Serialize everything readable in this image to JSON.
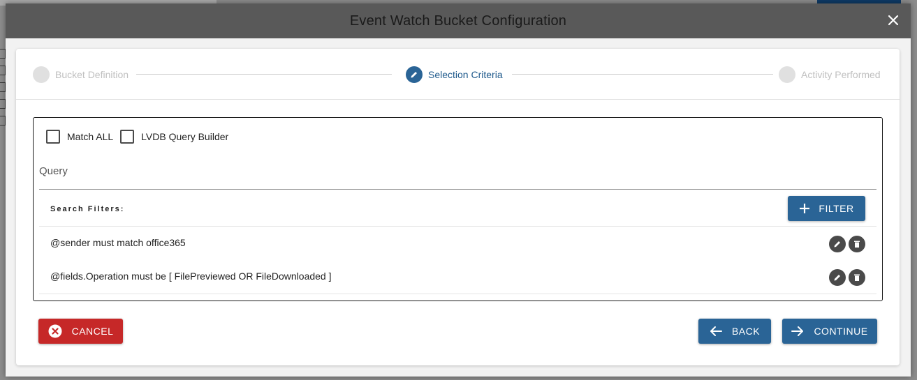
{
  "modal": {
    "title": "Event Watch Bucket Configuration"
  },
  "stepper": {
    "steps": [
      {
        "label": "Bucket Definition",
        "state": "inactive"
      },
      {
        "label": "Selection Criteria",
        "state": "active"
      },
      {
        "label": "Activity Performed",
        "state": "inactive"
      }
    ]
  },
  "options": {
    "match_all": {
      "label": "Match ALL",
      "checked": false
    },
    "lvdb_query_builder": {
      "label": "LVDB Query Builder",
      "checked": false
    }
  },
  "query": {
    "label": "Query"
  },
  "filters": {
    "title": "Search Filters:",
    "add_label": "FILTER",
    "items": [
      {
        "text": "@sender must match office365"
      },
      {
        "text": "@fields.Operation must be [ FilePreviewed OR FileDownloaded ]"
      }
    ]
  },
  "footer": {
    "cancel_label": "CANCEL",
    "back_label": "BACK",
    "continue_label": "CONTINUE"
  },
  "colors": {
    "primary": "#2a6496",
    "danger": "#c62828",
    "header": "#595959"
  }
}
